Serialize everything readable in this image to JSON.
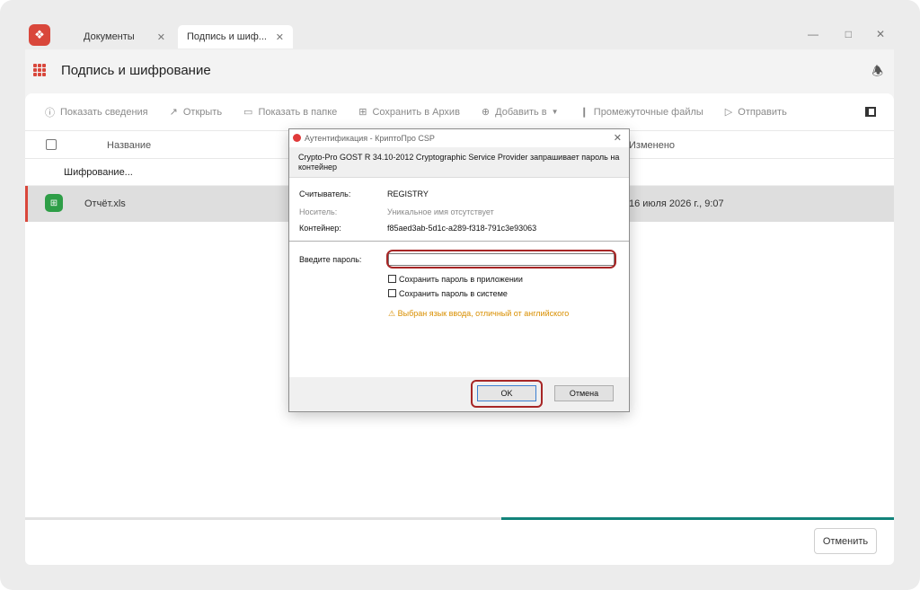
{
  "tabs": [
    {
      "label": "Документы"
    },
    {
      "label": "Подпись и шиф..."
    }
  ],
  "header": {
    "title": "Подпись и шифрование"
  },
  "toolbar": {
    "items": [
      {
        "label": "Показать сведения",
        "icon": "info-icon"
      },
      {
        "label": "Открыть",
        "icon": "open-icon"
      },
      {
        "label": "Показать в папке",
        "icon": "folder-icon"
      },
      {
        "label": "Сохранить в Архив",
        "icon": "archive-icon"
      },
      {
        "label": "Добавить в",
        "icon": "add-icon"
      },
      {
        "label": "Промежуточные файлы",
        "icon": "pin-icon"
      },
      {
        "label": "Отправить",
        "icon": "send-icon"
      }
    ]
  },
  "table": {
    "col_name": "Название",
    "col_changed": "Изменено",
    "group_label": "Шифрование...",
    "rows": [
      {
        "name": "Отчёт.xls",
        "changed": "16 июля 2026 г., 9:07"
      }
    ]
  },
  "progress": {
    "fraction": 0.548
  },
  "footer": {
    "cancel_label": "Отменить"
  },
  "dialog": {
    "title": "Аутентификация - КриптоПро CSP",
    "message": "Crypto-Pro GOST R 34.10-2012 Cryptographic Service Provider запрашивает пароль на контейнер",
    "reader_label": "Считыватель:",
    "reader_value": "REGISTRY",
    "media_label": "Носитель:",
    "media_value": "Уникальное имя отсутствует",
    "container_label": "Контейнер:",
    "container_value": "f85aed3ab-5d1c-a289-f318-791c3e93063",
    "password_label": "Введите пароль:",
    "password_value": "",
    "save_app_label": "Сохранить пароль в приложении",
    "save_system_label": "Сохранить пароль в системе",
    "warning": "Выбран язык ввода, отличный от английского",
    "ok_label": "OK",
    "cancel_label": "Отмена"
  },
  "colors": {
    "accent": "#d9473b",
    "highlight": "#a72626",
    "progress": "#12837a",
    "xls": "#2e9e47",
    "warning": "#d98f00"
  }
}
